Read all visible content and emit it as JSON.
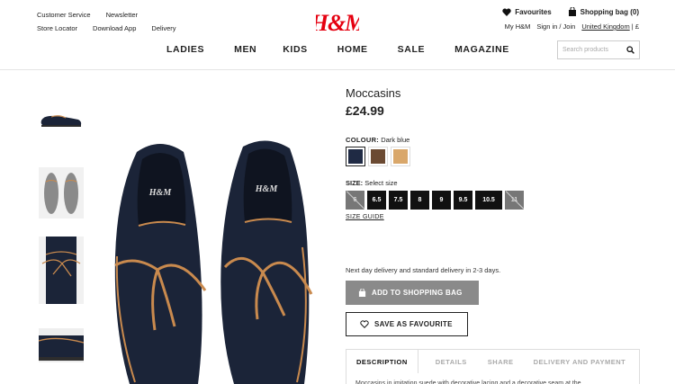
{
  "header": {
    "top_links_row1": [
      "Customer Service",
      "Newsletter"
    ],
    "top_links_row2": [
      "Store Locator",
      "Download App",
      "Delivery"
    ],
    "favourites": "Favourites",
    "shopping_bag": "Shopping bag (0)",
    "my_hm": "My H&M",
    "sign_in": "Sign in / Join",
    "country": "United Kingdom",
    "country_suffix": "| £",
    "logo_text": "H&M",
    "nav": [
      "LADIES",
      "MEN",
      "KIDS",
      "HOME",
      "SALE",
      "MAGAZINE"
    ],
    "search_placeholder": "Search products"
  },
  "product": {
    "name": "Moccasins",
    "price": "£24.99",
    "colour_label": "COLOUR:",
    "colour_value": "Dark blue",
    "swatches": [
      {
        "color": "#1f2a44",
        "selected": true
      },
      {
        "color": "#6b4a32",
        "selected": false
      },
      {
        "color": "#d9a76a",
        "selected": false
      }
    ],
    "size_label": "SIZE:",
    "size_hint": "Select size",
    "sizes": [
      {
        "label": "6",
        "available": false
      },
      {
        "label": "6.5",
        "available": true
      },
      {
        "label": "7.5",
        "available": true
      },
      {
        "label": "8",
        "available": true
      },
      {
        "label": "9",
        "available": true
      },
      {
        "label": "9.5",
        "available": true
      },
      {
        "label": "10.5",
        "available": true
      },
      {
        "label": "11",
        "available": false
      }
    ],
    "size_guide": "SIZE GUIDE",
    "delivery_note": "Next day delivery and standard delivery in 2-3 days.",
    "add_to_bag": "ADD TO SHOPPING BAG",
    "save_favourite": "SAVE AS FAVOURITE",
    "tabs": [
      "DESCRIPTION",
      "DETAILS",
      "SHARE",
      "DELIVERY AND PAYMENT"
    ],
    "description": "Moccasins in imitation suede with decorative lacing and a decorative seam at the"
  },
  "colors": {
    "brand_red": "#e50010",
    "shoe_navy": "#1b2438",
    "lace_tan": "#c98a4e"
  }
}
